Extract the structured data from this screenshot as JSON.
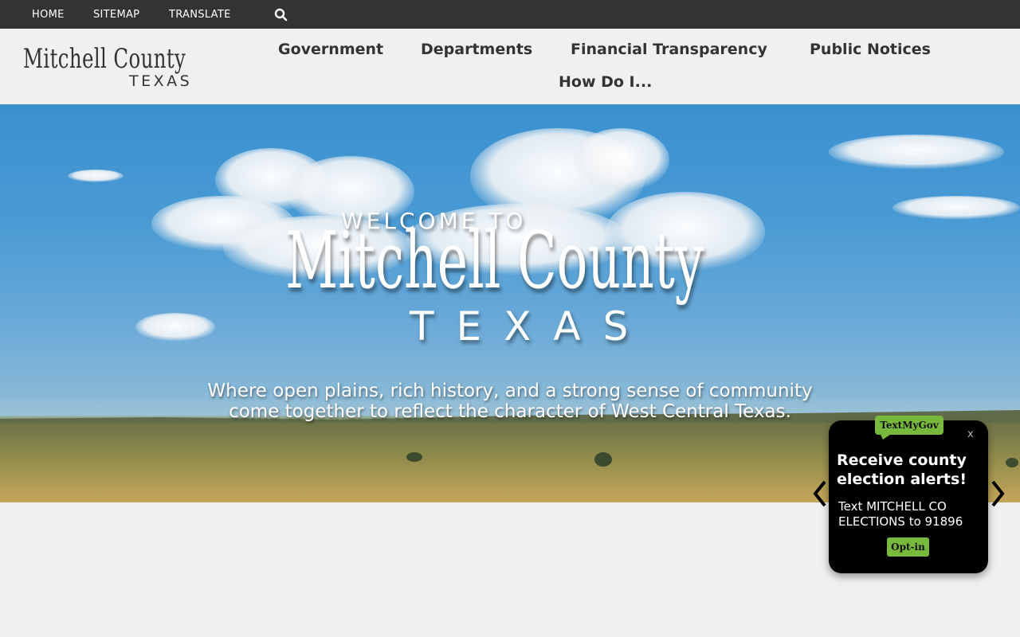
{
  "topbar": {
    "links": [
      "HOME",
      "SITEMAP",
      "TRANSLATE"
    ],
    "search_icon": "search-icon"
  },
  "header": {
    "logo_main": "Mitchell County",
    "logo_sub": "TEXAS",
    "nav": [
      "Government",
      "Departments",
      "Financial Transparency",
      "Public Notices",
      "How Do I..."
    ]
  },
  "hero": {
    "welcome": "WELCOME TO",
    "title": "Mitchell County",
    "state": "TEXAS",
    "tagline": "Where open plains, rich history, and a strong sense of community come together to reflect the character of West Central Texas."
  },
  "popup": {
    "brand": "TextMyGov",
    "close": "x",
    "title": "Receive county election alerts!",
    "text": "Text MITCHELL CO ELECTIONS to 91896",
    "button": "Opt-in",
    "prev_icon": "chevron-left-icon",
    "next_icon": "chevron-right-icon"
  },
  "colors": {
    "topbar": "#333333",
    "background": "#f0f0ee",
    "brand_green": "#78b83d",
    "popup_bg": "#000000"
  }
}
